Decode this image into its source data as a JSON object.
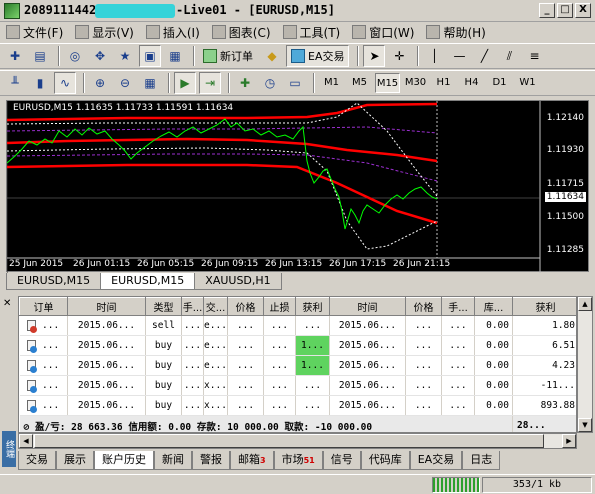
{
  "window": {
    "title_prefix": "2089111442:",
    "title_suffix": "-Live01 - [EURUSD,M15]",
    "controls": [
      "_",
      "□",
      "X"
    ]
  },
  "menu": [
    {
      "label": "文件(F)",
      "icon": "file-icon"
    },
    {
      "label": "显示(V)",
      "icon": "view-icon"
    },
    {
      "label": "插入(I)",
      "icon": "insert-icon"
    },
    {
      "label": "图表(C)",
      "icon": "chart-icon"
    },
    {
      "label": "工具(T)",
      "icon": "tools-icon"
    },
    {
      "label": "窗口(W)",
      "icon": "window-icon"
    },
    {
      "label": "帮助(H)",
      "icon": "help-icon"
    }
  ],
  "toolbar": {
    "new_order_label": "新订单",
    "ea_trading_label": "EA交易"
  },
  "timeframes": [
    "M1",
    "M5",
    "M15",
    "M30",
    "H1",
    "H4",
    "D1",
    "W1"
  ],
  "active_timeframe": "M15",
  "chart": {
    "info": "EURUSD,M15  1.11635 1.11733 1.11591 1.11634",
    "price_labels": [
      "1.12140",
      "1.11930",
      "1.11715",
      "1.11500",
      "1.11285"
    ],
    "current_price": "1.11634",
    "time_labels": [
      "25 Jun 2015",
      "26 Jun 01:15",
      "26 Jun 05:15",
      "26 Jun 09:15",
      "26 Jun 13:15",
      "26 Jun 17:15",
      "26 Jun 21:15"
    ],
    "colors": {
      "price": "#00ff00",
      "band": "#ff0000",
      "envelope": "#ffffff",
      "mid": "#9b2fd0"
    }
  },
  "chart_tabs": [
    {
      "label": "EURUSD,M15"
    },
    {
      "label": "EURUSD,M15"
    },
    {
      "label": "XAUUSD,H1"
    }
  ],
  "active_chart_tab": 1,
  "orders": {
    "headers": [
      "订单",
      "时间",
      "类型",
      "手...",
      "交...",
      "价格",
      "止损",
      "获利",
      "时间",
      "价格",
      "手...",
      "库...",
      "获利"
    ],
    "rows": [
      {
        "icon_color": "#d03a2a",
        "cells": [
          "...",
          "2015.06...",
          "sell",
          "...",
          "e...",
          "...",
          "...",
          "...",
          "2015.06...",
          "...",
          "...",
          "0.00",
          "1.80"
        ],
        "green": false
      },
      {
        "icon_color": "#2a7fd0",
        "cells": [
          "...",
          "2015.06...",
          "buy",
          "...",
          "e...",
          "...",
          "...",
          "1...",
          "2015.06...",
          "...",
          "...",
          "0.00",
          "6.51"
        ],
        "green": true
      },
      {
        "icon_color": "#2a7fd0",
        "cells": [
          "...",
          "2015.06...",
          "buy",
          "...",
          "e...",
          "...",
          "...",
          "1...",
          "2015.06...",
          "...",
          "...",
          "0.00",
          "4.23"
        ],
        "green": true
      },
      {
        "icon_color": "#2a7fd0",
        "cells": [
          "...",
          "2015.06...",
          "buy",
          "...",
          "x...",
          "...",
          "...",
          "...",
          "2015.06...",
          "...",
          "...",
          "0.00",
          "-11..."
        ],
        "green": false
      },
      {
        "icon_color": "#2a7fd0",
        "cells": [
          "...",
          "2015.06...",
          "buy",
          "...",
          "x...",
          "...",
          "...",
          "...",
          "2015.06...",
          "...",
          "...",
          "0.00",
          "893.88"
        ],
        "green": false
      }
    ],
    "summary": "盈/亏: 28 663.36  信用额: 0.00  存款: 10 000.00  取款: -10 000.00",
    "summary_end": "28..."
  },
  "terminal_label": "终端",
  "terminal_tabs": [
    {
      "label": "交易",
      "badge": ""
    },
    {
      "label": "展示",
      "badge": ""
    },
    {
      "label": "账户历史",
      "badge": ""
    },
    {
      "label": "新闻",
      "badge": ""
    },
    {
      "label": "警报",
      "badge": ""
    },
    {
      "label": "邮箱",
      "badge": "3"
    },
    {
      "label": "市场",
      "badge": "51"
    },
    {
      "label": "信号",
      "badge": ""
    },
    {
      "label": "代码库",
      "badge": ""
    },
    {
      "label": "EA交易",
      "badge": ""
    },
    {
      "label": "日志",
      "badge": ""
    }
  ],
  "active_terminal_tab": 2,
  "status": {
    "traffic": "353/1 kb"
  }
}
